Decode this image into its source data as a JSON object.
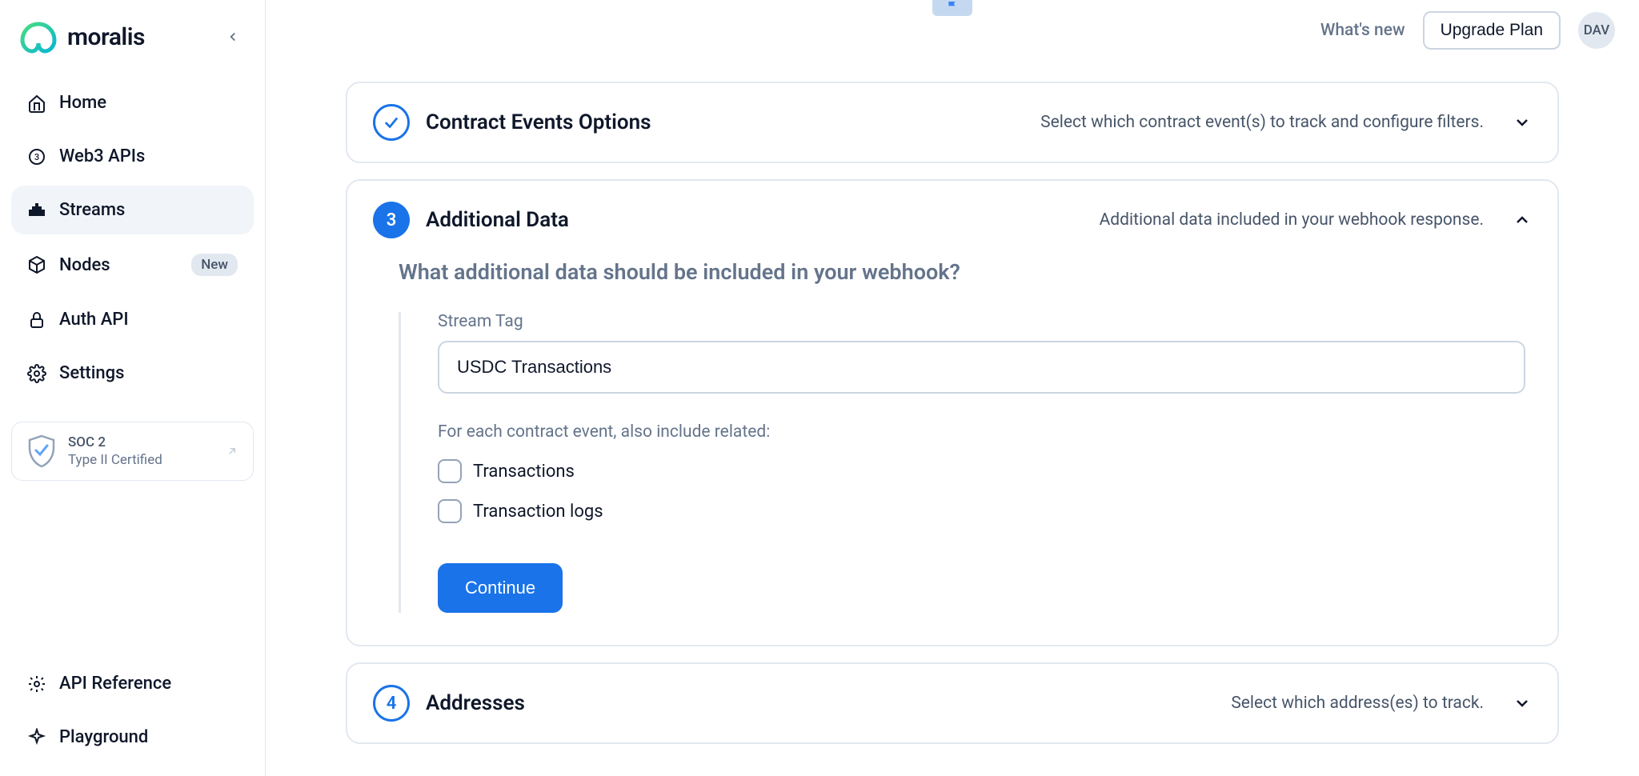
{
  "brand": "moralis",
  "sidebar": {
    "items": [
      {
        "label": "Home"
      },
      {
        "label": "Web3 APIs"
      },
      {
        "label": "Streams"
      },
      {
        "label": "Nodes",
        "badge": "New"
      },
      {
        "label": "Auth API"
      },
      {
        "label": "Settings"
      }
    ],
    "soc": {
      "title": "SOC 2",
      "subtitle": "Type II Certified"
    },
    "bottom": [
      {
        "label": "API Reference"
      },
      {
        "label": "Playground"
      }
    ]
  },
  "topbar": {
    "whatsnew": "What's new",
    "upgrade": "Upgrade Plan",
    "avatar": "DAV"
  },
  "sections": {
    "contract": {
      "title": "Contract Events Options",
      "subtitle": "Select which contract event(s) to track and configure filters."
    },
    "additional": {
      "step": "3",
      "title": "Additional Data",
      "subtitle": "Additional data included in your webhook response.",
      "question": "What additional data should be included in your webhook?",
      "tagLabel": "Stream Tag",
      "tagValue": "USDC Transactions",
      "includeLabel": "For each contract event, also include related:",
      "cb1": "Transactions",
      "cb2": "Transaction logs",
      "continue": "Continue"
    },
    "addresses": {
      "step": "4",
      "title": "Addresses",
      "subtitle": "Select which address(es) to track."
    }
  }
}
